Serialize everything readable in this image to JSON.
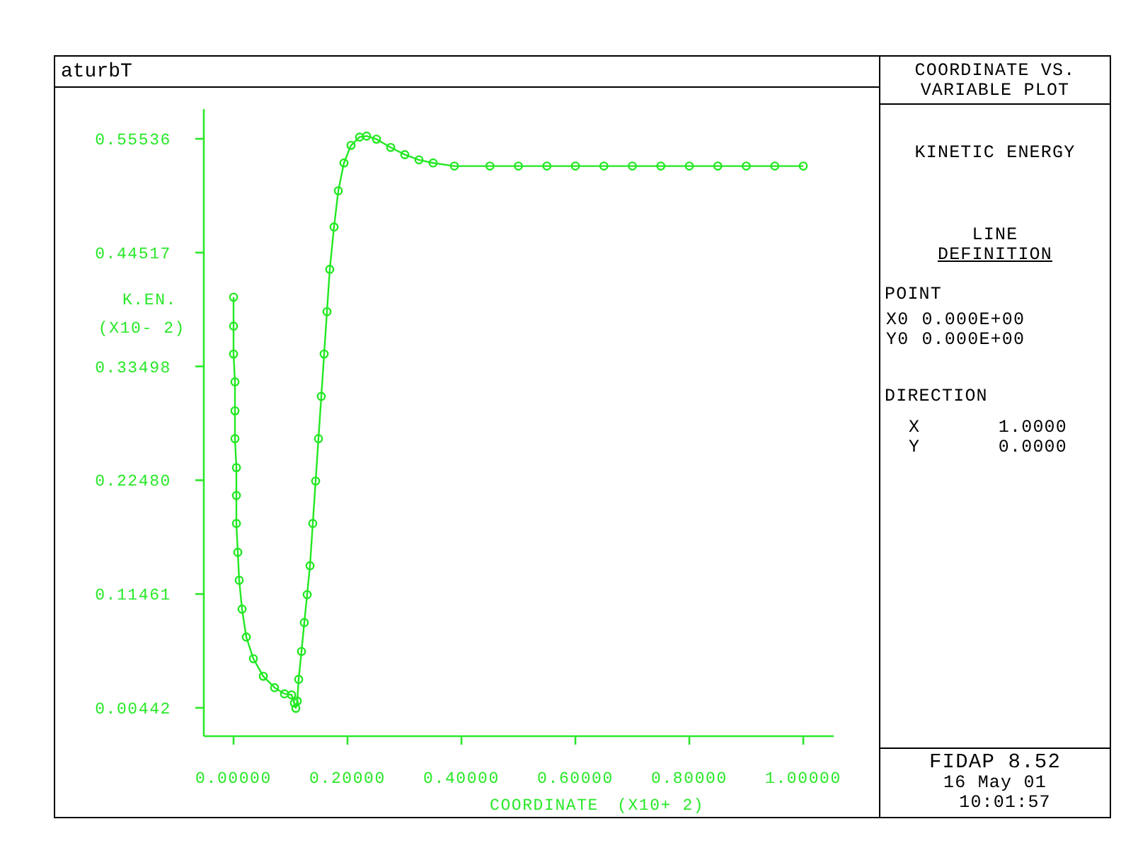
{
  "window": {
    "title": "aturbT"
  },
  "plot": {
    "chart_data": {
      "type": "line",
      "xlabel": "COORDINATE",
      "ylabel": "K.EN.",
      "x": [
        0,
        0,
        0,
        0.0025,
        0.0025,
        0.0025,
        0.005,
        0.005,
        0.005,
        0.0075,
        0.0099,
        0.0149,
        0.0224,
        0.0348,
        0.0522,
        0.072,
        0.0894,
        0.1019,
        0.1068,
        0.1093,
        0.1118,
        0.1143,
        0.1193,
        0.1242,
        0.1292,
        0.1342,
        0.1391,
        0.1441,
        0.1491,
        0.154,
        0.159,
        0.164,
        0.1689,
        0.1764,
        0.1839,
        0.1938,
        0.2062,
        0.2211,
        0.2335,
        0.2509,
        0.2758,
        0.3006,
        0.3255,
        0.3503,
        0.3876,
        0.45,
        0.5,
        0.55,
        0.6,
        0.65,
        0.7,
        0.75,
        0.8,
        0.85,
        0.9,
        0.95,
        1.0
      ],
      "series": [
        {
          "color": "#22e822",
          "marker": "circle",
          "values": [
            0.402,
            0.374,
            0.347,
            0.32,
            0.292,
            0.265,
            0.237,
            0.21,
            0.183,
            0.155,
            0.128,
            0.1,
            0.073,
            0.052,
            0.035,
            0.024,
            0.018,
            0.017,
            0.009,
            0.004,
            0.011,
            0.032,
            0.059,
            0.087,
            0.114,
            0.142,
            0.183,
            0.224,
            0.265,
            0.306,
            0.347,
            0.388,
            0.429,
            0.47,
            0.505,
            0.532,
            0.549,
            0.557,
            0.558,
            0.555,
            0.547,
            0.54,
            0.535,
            0.532,
            0.529,
            0.529,
            0.529,
            0.529,
            0.529,
            0.529,
            0.529,
            0.529,
            0.529,
            0.529,
            0.529,
            0.529,
            0.529
          ]
        }
      ],
      "xlim": [
        -0.0522,
        1.0534
      ],
      "ylim": [
        -0.023,
        0.5842
      ],
      "xticks": [
        {
          "value": 0,
          "label": "0.00000"
        },
        {
          "value": 0.2,
          "label": "0.20000"
        },
        {
          "value": 0.4,
          "label": "0.40000"
        },
        {
          "value": 0.6,
          "label": "0.60000"
        },
        {
          "value": 0.8,
          "label": "0.80000"
        },
        {
          "value": 1.0,
          "label": "1.00000"
        }
      ],
      "yticks": [
        {
          "value": 0.00442,
          "label": "0.00442"
        },
        {
          "value": 0.11461,
          "label": "0.11461"
        },
        {
          "value": 0.2248,
          "label": "0.22480"
        },
        {
          "value": 0.33498,
          "label": "0.33498"
        },
        {
          "value": 0.44517,
          "label": "0.44517"
        },
        {
          "value": 0.55536,
          "label": "0.55536"
        }
      ]
    },
    "x_scale_note": "(X10+ 2)",
    "y_scale_note": "(X10- 2)"
  },
  "side_panel": {
    "heading": [
      "COORDINATE VS.",
      "VARIABLE PLOT"
    ],
    "variable": "KINETIC ENERGY",
    "section_title": [
      "LINE",
      "DEFINITION"
    ],
    "point": {
      "label": "POINT",
      "rows": [
        {
          "name": "X0",
          "value": "0.000E+00"
        },
        {
          "name": "Y0",
          "value": "0.000E+00"
        }
      ]
    },
    "direction": {
      "label": "DIRECTION",
      "rows": [
        {
          "name": "X",
          "value": "1.0000"
        },
        {
          "name": "Y",
          "value": "0.0000"
        }
      ]
    }
  },
  "footer": {
    "program": "FIDAP 8.52",
    "date": "16 May 01",
    "time": "10:01:57"
  }
}
